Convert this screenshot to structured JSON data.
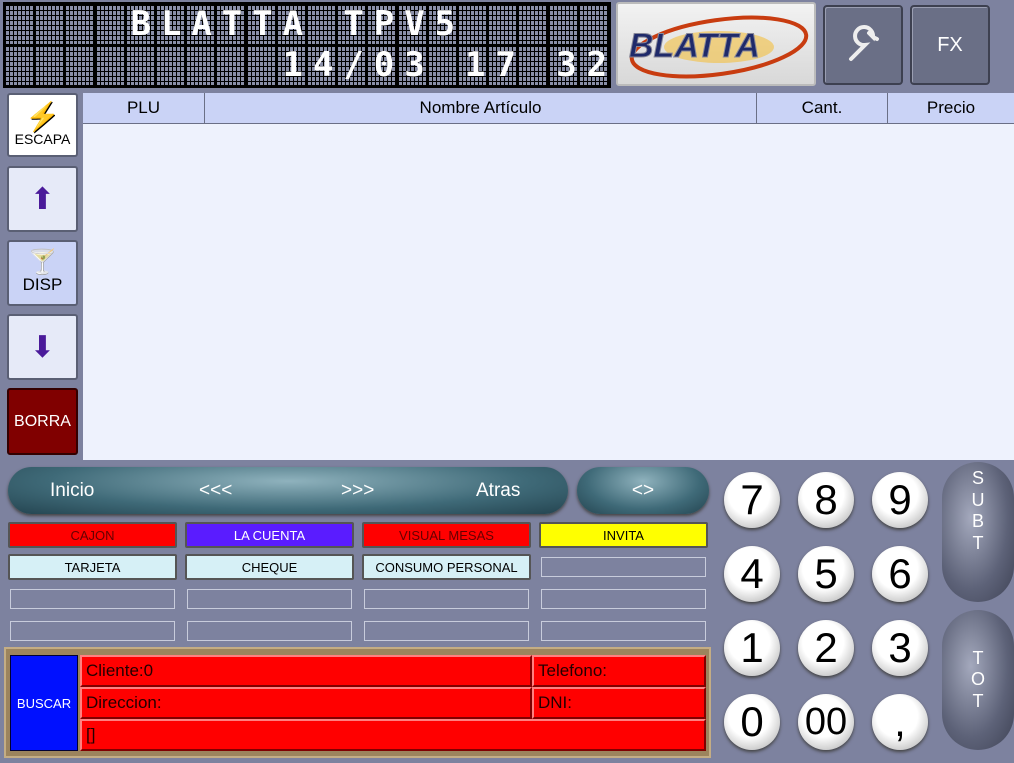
{
  "display": {
    "line1": "    BLATTA TPV5     ",
    "line2": "         14/03 17 32"
  },
  "header": {
    "logo_text": "BLATTA",
    "settings_icon": "wrench-icon",
    "fx_label": "FX"
  },
  "side": {
    "escapa": "ESCAPA",
    "disp": "DISP",
    "borra": "BORRA"
  },
  "table": {
    "columns": [
      "PLU",
      "Nombre Artículo",
      "Cant.",
      "Precio"
    ],
    "rows": []
  },
  "nav": {
    "inicio": "Inicio",
    "prev": "<<<",
    "next": ">>>",
    "atras": "Atras",
    "toggle": "<>"
  },
  "functions": [
    {
      "label": "CAJON",
      "color": "#ff0000",
      "text": "#600"
    },
    {
      "label": "LA CUENTA",
      "color": "#5a1cff",
      "text": "#fff"
    },
    {
      "label": "VISUAL MESAS",
      "color": "#ff0000",
      "text": "#600"
    },
    {
      "label": "INVITA",
      "color": "#ffff00",
      "text": "#000"
    },
    {
      "label": "TARJETA",
      "color": "#d6f0f6",
      "text": "#000"
    },
    {
      "label": "CHEQUE",
      "color": "#d6f0f6",
      "text": "#000"
    },
    {
      "label": "CONSUMO PERSONAL",
      "color": "#d6f0f6",
      "text": "#000"
    }
  ],
  "customer": {
    "buscar": "BUSCAR",
    "cliente": "Cliente:0",
    "telefono": "Telefono:",
    "direccion": "Direccion:",
    "dni": "DNI:",
    "extra": "[]"
  },
  "keypad": {
    "keys": [
      "7",
      "8",
      "9",
      "4",
      "5",
      "6",
      "1",
      "2",
      "3",
      "0",
      "00",
      ","
    ],
    "subt": [
      "S",
      "U",
      "B",
      "T"
    ],
    "tot": [
      "T",
      "O",
      "T"
    ]
  }
}
